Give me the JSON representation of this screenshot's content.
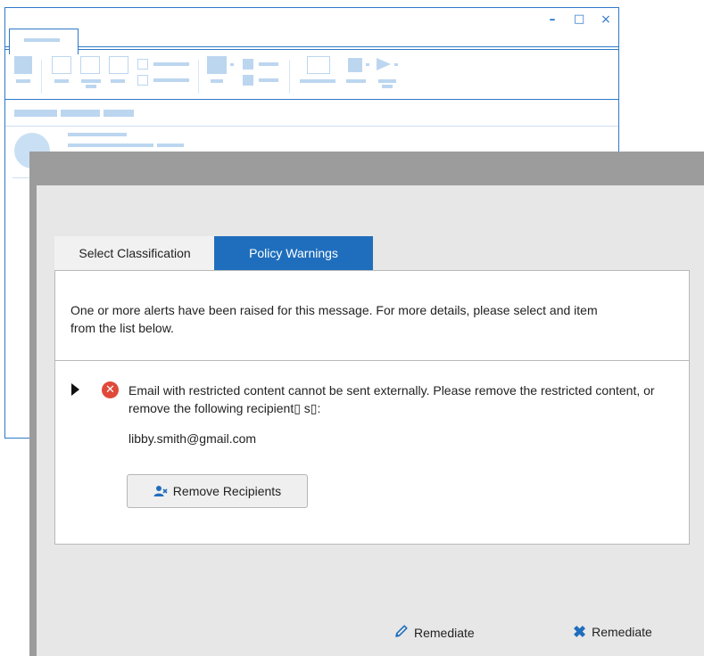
{
  "background_window": {
    "controls": {
      "minimize": "–",
      "maximize": "□",
      "close": "×"
    }
  },
  "dialog": {
    "tabs": [
      {
        "label": "Select Classification",
        "active": false
      },
      {
        "label": "Policy Warnings",
        "active": true
      }
    ],
    "intro_text": "One or more alerts have been raised for this message. For more details, please select and item from the list below.",
    "alert": {
      "icon": "error-icon",
      "message": "Email with restricted content cannot be sent externally. Please remove the restricted content, or remove the following recipient▯ s▯:",
      "recipient": "libby.smith@gmail.com",
      "remove_button_label": "Remove Recipients"
    },
    "actions": [
      {
        "label": "Remediate",
        "icon": "pencil-icon"
      },
      {
        "label": "Remediate",
        "icon": "x-icon"
      }
    ],
    "colors": {
      "accent": "#1f6ebd",
      "error": "#e0493a",
      "wireframe": "#2f79c9"
    }
  }
}
